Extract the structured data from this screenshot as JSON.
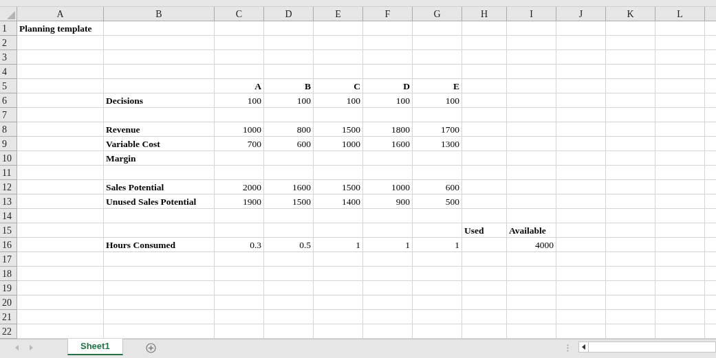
{
  "columns": [
    "A",
    "B",
    "C",
    "D",
    "E",
    "F",
    "G",
    "H",
    "I",
    "J",
    "K",
    "L"
  ],
  "rows": [
    {
      "header": "1",
      "cells": [
        {
          "kind": "text",
          "text": "Planning template"
        },
        null,
        null,
        null,
        null,
        null,
        null,
        null,
        null,
        null,
        null,
        null
      ]
    },
    {
      "header": "2",
      "cells": []
    },
    {
      "header": "3",
      "cells": []
    },
    {
      "header": "4",
      "cells": []
    },
    {
      "header": "5",
      "cells": [
        null,
        null,
        {
          "kind": "heading",
          "text": "A"
        },
        {
          "kind": "heading",
          "text": "B"
        },
        {
          "kind": "heading",
          "text": "C"
        },
        {
          "kind": "heading",
          "text": "D"
        },
        {
          "kind": "heading",
          "text": "E"
        }
      ]
    },
    {
      "header": "6",
      "cells": [
        null,
        {
          "kind": "text",
          "text": "Decisions"
        },
        {
          "kind": "number",
          "text": "100"
        },
        {
          "kind": "number",
          "text": "100"
        },
        {
          "kind": "number",
          "text": "100"
        },
        {
          "kind": "number",
          "text": "100"
        },
        {
          "kind": "number",
          "text": "100"
        }
      ]
    },
    {
      "header": "7",
      "cells": []
    },
    {
      "header": "8",
      "cells": [
        null,
        {
          "kind": "text",
          "text": "Revenue"
        },
        {
          "kind": "number",
          "text": "1000"
        },
        {
          "kind": "number",
          "text": "800"
        },
        {
          "kind": "number",
          "text": "1500"
        },
        {
          "kind": "number",
          "text": "1800"
        },
        {
          "kind": "number",
          "text": "1700"
        }
      ]
    },
    {
      "header": "9",
      "cells": [
        null,
        {
          "kind": "text",
          "text": "Variable Cost"
        },
        {
          "kind": "number",
          "text": "700"
        },
        {
          "kind": "number",
          "text": "600"
        },
        {
          "kind": "number",
          "text": "1000"
        },
        {
          "kind": "number",
          "text": "1600"
        },
        {
          "kind": "number",
          "text": "1300"
        }
      ]
    },
    {
      "header": "10",
      "cells": [
        null,
        {
          "kind": "text",
          "text": "Margin"
        }
      ]
    },
    {
      "header": "11",
      "cells": []
    },
    {
      "header": "12",
      "cells": [
        null,
        {
          "kind": "text",
          "text": "Sales Potential"
        },
        {
          "kind": "number",
          "text": "2000"
        },
        {
          "kind": "number",
          "text": "1600"
        },
        {
          "kind": "number",
          "text": "1500"
        },
        {
          "kind": "number",
          "text": "1000"
        },
        {
          "kind": "number",
          "text": "600"
        }
      ]
    },
    {
      "header": "13",
      "cells": [
        null,
        {
          "kind": "text",
          "text": "Unused Sales Potential"
        },
        {
          "kind": "number",
          "text": "1900"
        },
        {
          "kind": "number",
          "text": "1500"
        },
        {
          "kind": "number",
          "text": "1400"
        },
        {
          "kind": "number",
          "text": "900"
        },
        {
          "kind": "number",
          "text": "500"
        }
      ]
    },
    {
      "header": "14",
      "cells": []
    },
    {
      "header": "15",
      "cells": [
        null,
        null,
        null,
        null,
        null,
        null,
        null,
        {
          "kind": "text",
          "text": "Used"
        },
        {
          "kind": "text",
          "text": "Available"
        }
      ]
    },
    {
      "header": "16",
      "cells": [
        null,
        {
          "kind": "text",
          "text": "Hours Consumed"
        },
        {
          "kind": "number",
          "text": "0.3"
        },
        {
          "kind": "number",
          "text": "0.5"
        },
        {
          "kind": "number",
          "text": "1"
        },
        {
          "kind": "number",
          "text": "1"
        },
        {
          "kind": "number",
          "text": "1"
        },
        null,
        {
          "kind": "number",
          "text": "4000"
        }
      ]
    },
    {
      "header": "17",
      "cells": []
    },
    {
      "header": "18",
      "cells": []
    },
    {
      "header": "19",
      "cells": []
    },
    {
      "header": "20",
      "cells": []
    },
    {
      "header": "21",
      "cells": []
    },
    {
      "header": "22",
      "cells": []
    }
  ],
  "sheet_tabs": [
    {
      "label": "Sheet1",
      "selected": true
    }
  ]
}
